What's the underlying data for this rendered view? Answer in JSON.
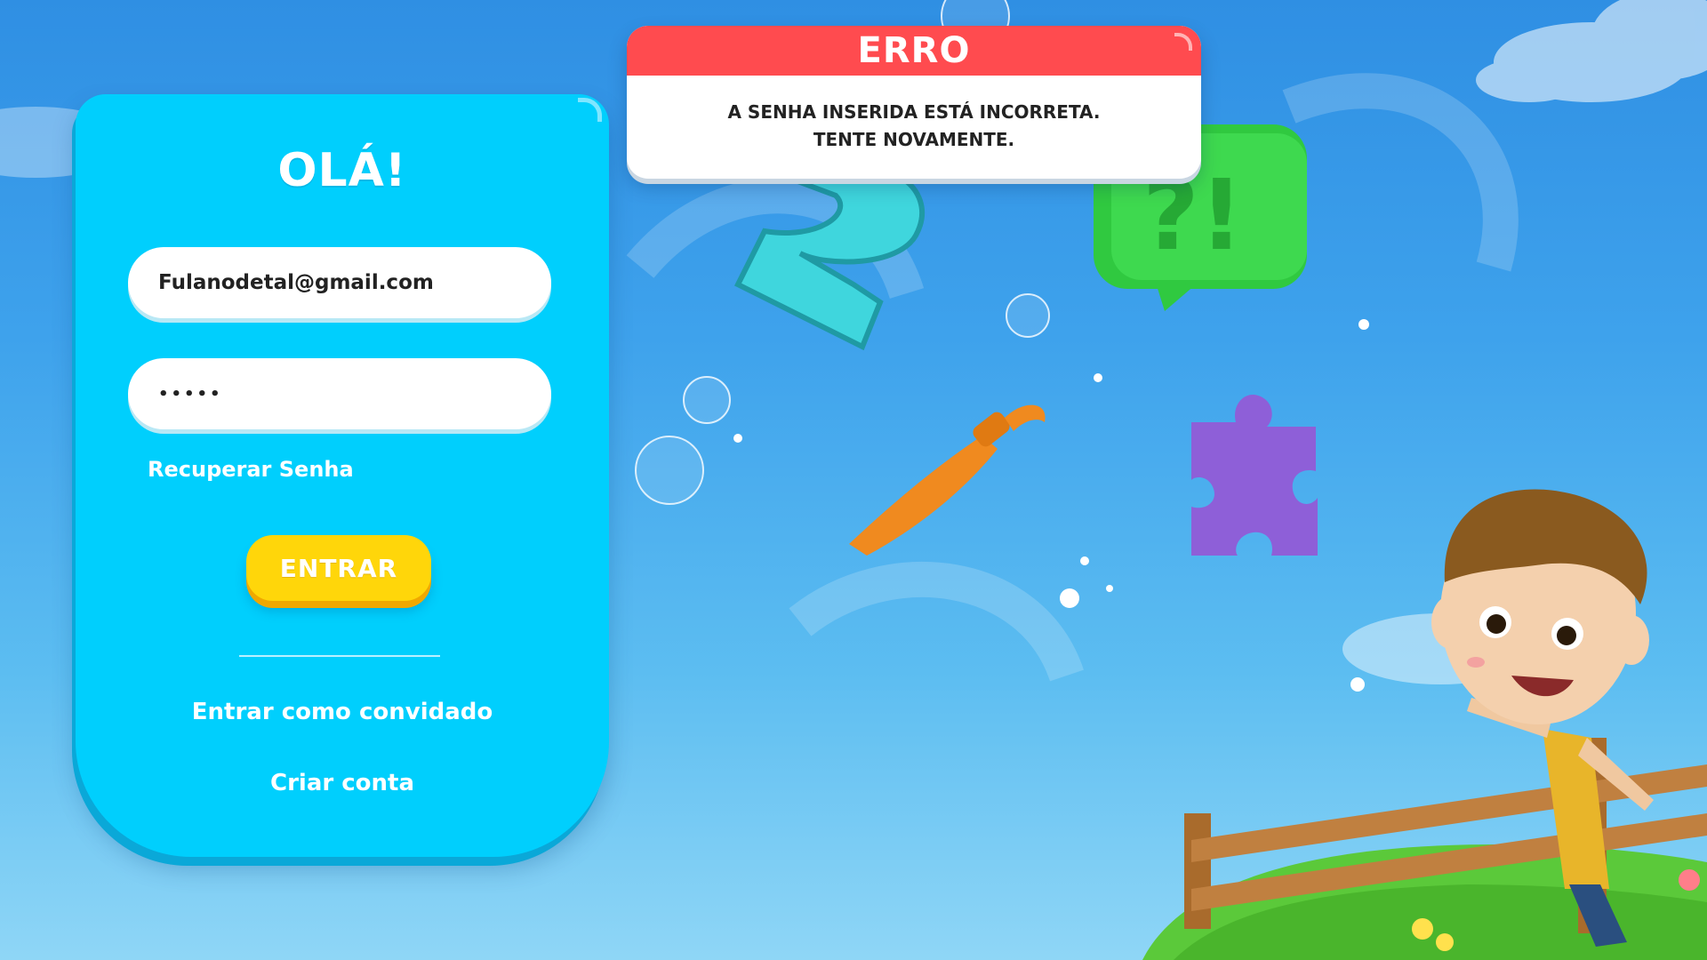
{
  "login_card": {
    "title": "OLÁ!",
    "email_value": "Fulanodetal@gmail.com",
    "password_mask": "•••••",
    "recover_link": "Recuperar Senha",
    "enter_button": "ENTRAR",
    "guest_link": "Entrar como convidado",
    "create_account_link": "Criar conta"
  },
  "error_modal": {
    "title": "ERRO",
    "message_line1": "A SENHA INSERIDA ESTÁ INCORRETA.",
    "message_line2": "TENTE NOVAMENTE."
  },
  "colors": {
    "card": "#00cffd",
    "button": "#ffd60a",
    "error_header": "#ff4b4f",
    "background": "#3ea2ec"
  },
  "icons": [
    "number-two-icon",
    "speech-bubble-question-exclamation-icon",
    "paintbrush-icon",
    "puzzle-piece-icon"
  ]
}
